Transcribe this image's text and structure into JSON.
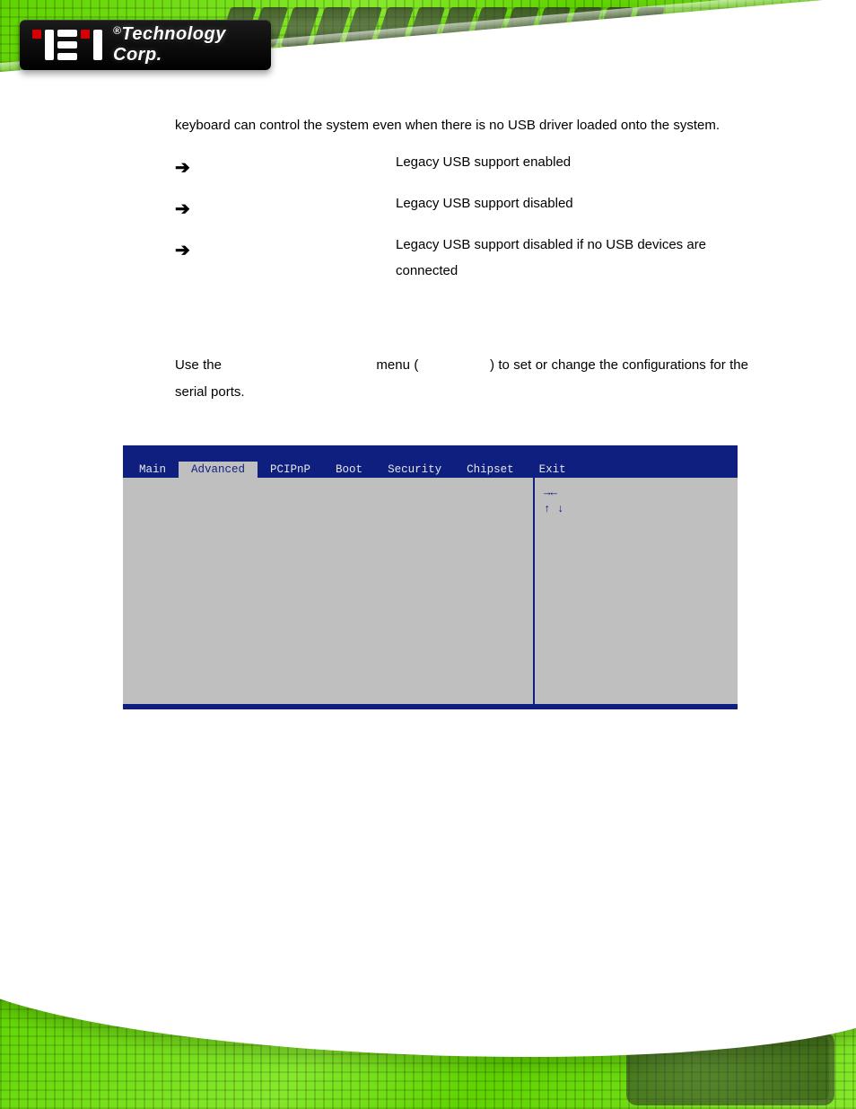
{
  "brand": {
    "reg": "®",
    "name": "Technology Corp."
  },
  "intro_paragraph": "keyboard can control the system even when there is no USB driver loaded onto the system.",
  "usb_options": [
    {
      "label": "",
      "description": "Legacy USB support enabled"
    },
    {
      "label": "",
      "description": "Legacy USB support disabled"
    },
    {
      "label": "",
      "description": "Legacy USB support disabled if no USB devices are connected"
    }
  ],
  "para2_pre": "Use the ",
  "para2_mid": " menu (",
  "para2_post": ") to set or change the configurations for the serial ports.",
  "bios": {
    "tabs": [
      "Main",
      "Advanced",
      "PCIPnP",
      "Boot",
      "Security",
      "Chipset",
      "Exit"
    ],
    "active_tab_index": 1,
    "left_items": [
      ""
    ],
    "right_help": [
      "",
      "",
      "",
      "",
      "",
      "→←",
      "↑ ↓",
      "",
      "",
      "",
      "",
      ""
    ],
    "footer": ""
  }
}
